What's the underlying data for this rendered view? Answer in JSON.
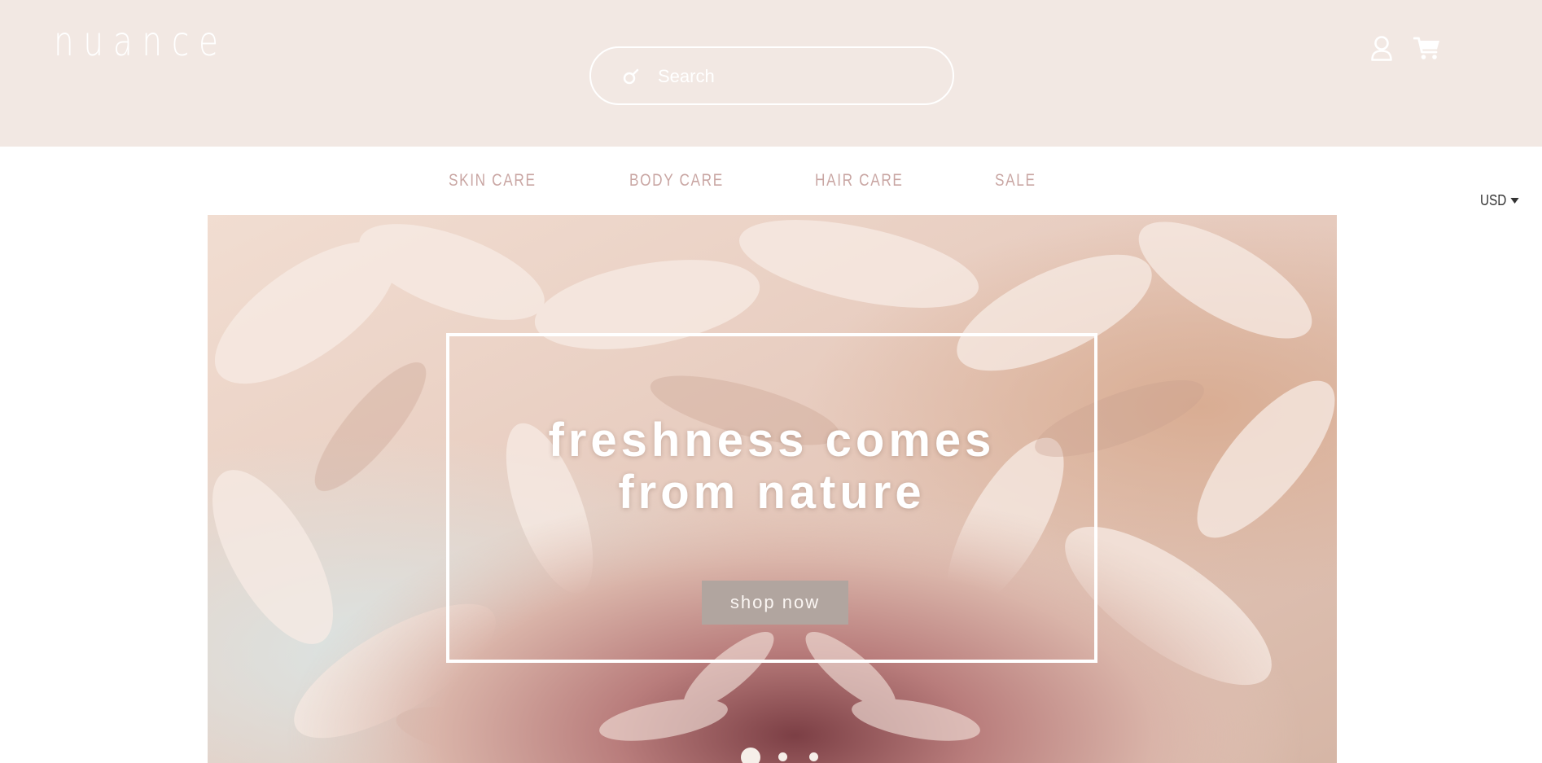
{
  "header": {
    "logo": "nuance",
    "search_placeholder": "Search"
  },
  "nav": {
    "items": [
      {
        "label": "SKIN CARE"
      },
      {
        "label": "BODY CARE"
      },
      {
        "label": "HAIR CARE"
      },
      {
        "label": "SALE"
      }
    ]
  },
  "currency": {
    "selected": "USD"
  },
  "hero": {
    "headline_line1": "freshness comes",
    "headline_line2": "from nature",
    "cta_label": "shop now",
    "slide_count": 3,
    "active_slide": 1
  },
  "icons": {
    "search": "search-icon",
    "account": "user-icon",
    "cart": "cart-icon",
    "currency_caret": "caret-down-icon"
  },
  "colors": {
    "header_bg": "#f2e8e3",
    "nav_text": "#c9a6a3",
    "cta_bg": "#b1a59f"
  }
}
